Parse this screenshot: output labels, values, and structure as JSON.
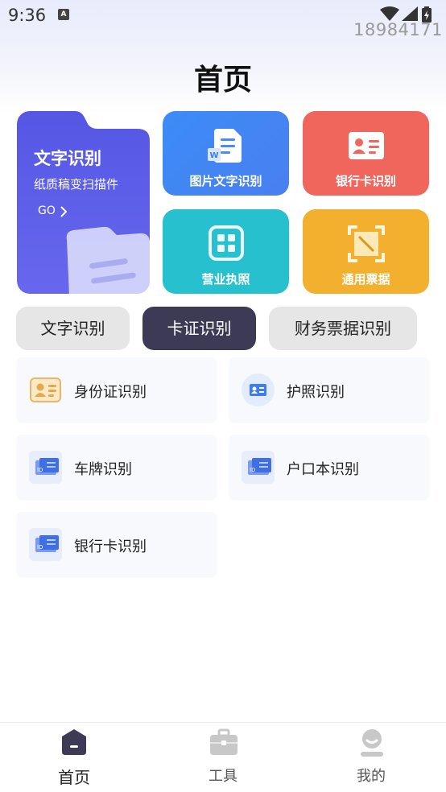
{
  "status": {
    "time": "9:36",
    "notif_icon": "A",
    "device_id": "18984171"
  },
  "page": {
    "title": "首页"
  },
  "feature_main": {
    "title": "文字识别",
    "subtitle": "纸质稿变扫描件",
    "go": "GO",
    "color": "#5b5ce6"
  },
  "feature_cards": {
    "picture": {
      "label": "图片文字识别",
      "icon": "word-doc-icon",
      "color": "#3f89f5"
    },
    "bank": {
      "label": "银行卡识别",
      "icon": "id-card-icon",
      "color": "#f0655c"
    },
    "business": {
      "label": "营业执照",
      "icon": "scan-frame-icon",
      "color": "#26c0cf"
    },
    "bill": {
      "label": "通用票据",
      "icon": "receipt-scan-icon",
      "color": "#f2b02e"
    }
  },
  "tabs": [
    {
      "label": "文字识别",
      "active": false
    },
    {
      "label": "卡证识别",
      "active": true
    },
    {
      "label": "财务票据识别",
      "active": false
    }
  ],
  "items": [
    {
      "label": "身份证识别",
      "icon": "id-card-gold-icon"
    },
    {
      "label": "护照识别",
      "icon": "passport-icon"
    },
    {
      "label": "车牌识别",
      "icon": "license-plate-icon"
    },
    {
      "label": "户口本识别",
      "icon": "household-register-icon"
    },
    {
      "label": "银行卡识别",
      "icon": "bank-card-icon"
    }
  ],
  "bottom_nav": [
    {
      "label": "首页",
      "icon": "home-icon",
      "active": true
    },
    {
      "label": "工具",
      "icon": "toolbox-icon",
      "active": false
    },
    {
      "label": "我的",
      "icon": "profile-icon",
      "active": false
    }
  ],
  "colors": {
    "active_tab": "#3d3a56",
    "nav_active": "#3d3a56",
    "nav_inactive": "#c8c8c8"
  }
}
